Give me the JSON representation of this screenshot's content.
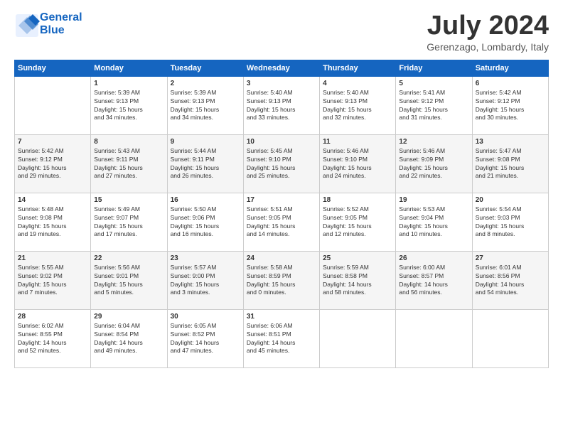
{
  "logo": {
    "line1": "General",
    "line2": "Blue"
  },
  "title": "July 2024",
  "location": "Gerenzago, Lombardy, Italy",
  "weekdays": [
    "Sunday",
    "Monday",
    "Tuesday",
    "Wednesday",
    "Thursday",
    "Friday",
    "Saturday"
  ],
  "weeks": [
    [
      {
        "day": "",
        "info": ""
      },
      {
        "day": "1",
        "info": "Sunrise: 5:39 AM\nSunset: 9:13 PM\nDaylight: 15 hours\nand 34 minutes."
      },
      {
        "day": "2",
        "info": "Sunrise: 5:39 AM\nSunset: 9:13 PM\nDaylight: 15 hours\nand 34 minutes."
      },
      {
        "day": "3",
        "info": "Sunrise: 5:40 AM\nSunset: 9:13 PM\nDaylight: 15 hours\nand 33 minutes."
      },
      {
        "day": "4",
        "info": "Sunrise: 5:40 AM\nSunset: 9:13 PM\nDaylight: 15 hours\nand 32 minutes."
      },
      {
        "day": "5",
        "info": "Sunrise: 5:41 AM\nSunset: 9:12 PM\nDaylight: 15 hours\nand 31 minutes."
      },
      {
        "day": "6",
        "info": "Sunrise: 5:42 AM\nSunset: 9:12 PM\nDaylight: 15 hours\nand 30 minutes."
      }
    ],
    [
      {
        "day": "7",
        "info": "Sunrise: 5:42 AM\nSunset: 9:12 PM\nDaylight: 15 hours\nand 29 minutes."
      },
      {
        "day": "8",
        "info": "Sunrise: 5:43 AM\nSunset: 9:11 PM\nDaylight: 15 hours\nand 27 minutes."
      },
      {
        "day": "9",
        "info": "Sunrise: 5:44 AM\nSunset: 9:11 PM\nDaylight: 15 hours\nand 26 minutes."
      },
      {
        "day": "10",
        "info": "Sunrise: 5:45 AM\nSunset: 9:10 PM\nDaylight: 15 hours\nand 25 minutes."
      },
      {
        "day": "11",
        "info": "Sunrise: 5:46 AM\nSunset: 9:10 PM\nDaylight: 15 hours\nand 24 minutes."
      },
      {
        "day": "12",
        "info": "Sunrise: 5:46 AM\nSunset: 9:09 PM\nDaylight: 15 hours\nand 22 minutes."
      },
      {
        "day": "13",
        "info": "Sunrise: 5:47 AM\nSunset: 9:08 PM\nDaylight: 15 hours\nand 21 minutes."
      }
    ],
    [
      {
        "day": "14",
        "info": "Sunrise: 5:48 AM\nSunset: 9:08 PM\nDaylight: 15 hours\nand 19 minutes."
      },
      {
        "day": "15",
        "info": "Sunrise: 5:49 AM\nSunset: 9:07 PM\nDaylight: 15 hours\nand 17 minutes."
      },
      {
        "day": "16",
        "info": "Sunrise: 5:50 AM\nSunset: 9:06 PM\nDaylight: 15 hours\nand 16 minutes."
      },
      {
        "day": "17",
        "info": "Sunrise: 5:51 AM\nSunset: 9:05 PM\nDaylight: 15 hours\nand 14 minutes."
      },
      {
        "day": "18",
        "info": "Sunrise: 5:52 AM\nSunset: 9:05 PM\nDaylight: 15 hours\nand 12 minutes."
      },
      {
        "day": "19",
        "info": "Sunrise: 5:53 AM\nSunset: 9:04 PM\nDaylight: 15 hours\nand 10 minutes."
      },
      {
        "day": "20",
        "info": "Sunrise: 5:54 AM\nSunset: 9:03 PM\nDaylight: 15 hours\nand 8 minutes."
      }
    ],
    [
      {
        "day": "21",
        "info": "Sunrise: 5:55 AM\nSunset: 9:02 PM\nDaylight: 15 hours\nand 7 minutes."
      },
      {
        "day": "22",
        "info": "Sunrise: 5:56 AM\nSunset: 9:01 PM\nDaylight: 15 hours\nand 5 minutes."
      },
      {
        "day": "23",
        "info": "Sunrise: 5:57 AM\nSunset: 9:00 PM\nDaylight: 15 hours\nand 3 minutes."
      },
      {
        "day": "24",
        "info": "Sunrise: 5:58 AM\nSunset: 8:59 PM\nDaylight: 15 hours\nand 0 minutes."
      },
      {
        "day": "25",
        "info": "Sunrise: 5:59 AM\nSunset: 8:58 PM\nDaylight: 14 hours\nand 58 minutes."
      },
      {
        "day": "26",
        "info": "Sunrise: 6:00 AM\nSunset: 8:57 PM\nDaylight: 14 hours\nand 56 minutes."
      },
      {
        "day": "27",
        "info": "Sunrise: 6:01 AM\nSunset: 8:56 PM\nDaylight: 14 hours\nand 54 minutes."
      }
    ],
    [
      {
        "day": "28",
        "info": "Sunrise: 6:02 AM\nSunset: 8:55 PM\nDaylight: 14 hours\nand 52 minutes."
      },
      {
        "day": "29",
        "info": "Sunrise: 6:04 AM\nSunset: 8:54 PM\nDaylight: 14 hours\nand 49 minutes."
      },
      {
        "day": "30",
        "info": "Sunrise: 6:05 AM\nSunset: 8:52 PM\nDaylight: 14 hours\nand 47 minutes."
      },
      {
        "day": "31",
        "info": "Sunrise: 6:06 AM\nSunset: 8:51 PM\nDaylight: 14 hours\nand 45 minutes."
      },
      {
        "day": "",
        "info": ""
      },
      {
        "day": "",
        "info": ""
      },
      {
        "day": "",
        "info": ""
      }
    ]
  ]
}
